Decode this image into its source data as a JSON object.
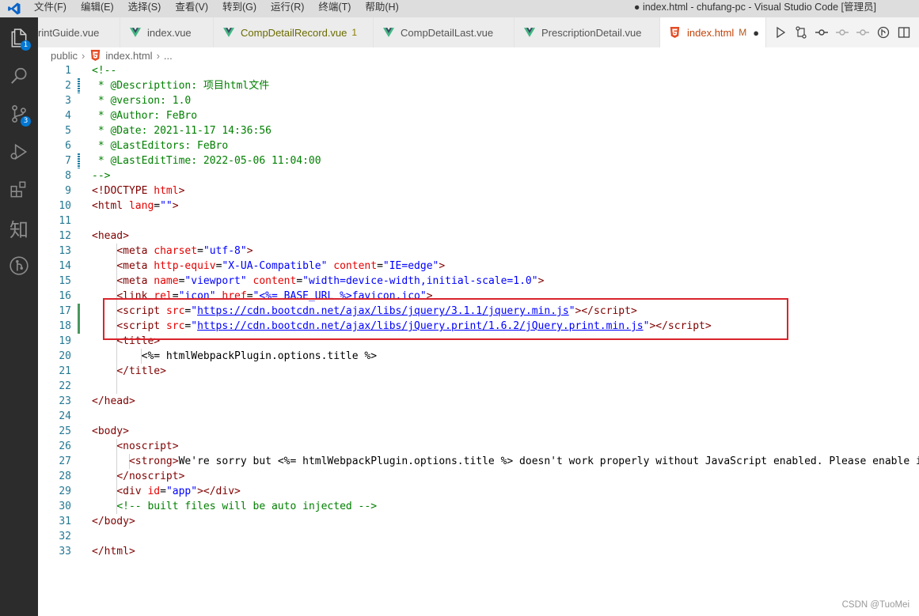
{
  "titlebar": {
    "menu": [
      "文件(F)",
      "编辑(E)",
      "选择(S)",
      "查看(V)",
      "转到(G)",
      "运行(R)",
      "终端(T)",
      "帮助(H)"
    ],
    "window_title": "● index.html - chufang-pc - Visual Studio Code [管理员]"
  },
  "activity_bar": {
    "explorer_badge": "1",
    "scm_badge": "3",
    "zhi_label": "知"
  },
  "tabs": [
    {
      "label": "rintGuide.vue",
      "icon": "vue-icon"
    },
    {
      "label": "index.vue",
      "icon": "vue-icon"
    },
    {
      "label": "CompDetailRecord.vue",
      "icon": "vue-icon",
      "badge": "1"
    },
    {
      "label": "CompDetailLast.vue",
      "icon": "vue-icon"
    },
    {
      "label": "PrescriptionDetail.vue",
      "icon": "vue-icon"
    },
    {
      "label": "index.html",
      "icon": "html5-icon",
      "modified": "M",
      "dirty": "●",
      "active": true
    }
  ],
  "breadcrumb": {
    "folder": "public",
    "file": "index.html",
    "more": "..."
  },
  "code_lines": [
    "1",
    "2",
    "3",
    "4",
    "5",
    "6",
    "7",
    "8",
    "9",
    "10",
    "11",
    "12",
    "13",
    "14",
    "15",
    "16",
    "17",
    "18",
    "19",
    "20",
    "21",
    "22",
    "23",
    "24",
    "25",
    "26",
    "27",
    "28",
    "29",
    "30",
    "31",
    "32",
    "33"
  ],
  "code": {
    "l1": "<!--",
    "l2_star": " * ",
    "l2_text": "@Descripttion: 项目html文件",
    "l3": " * @version: 1.0",
    "l4": " * @Author: FeBro",
    "l5": " * @Date: 2021-11-17 14:36:56",
    "l6": " * @LastEditors: FeBro",
    "l7": " * @LastEditTime: 2022-05-06 11:04:00",
    "l8": "-->",
    "l27_text": "We're sorry but <%= htmlWebpackPlugin.options.title %> doesn't work properly without JavaScript enabled. Please enable it",
    "l20_text": "<%= htmlWebpackPlugin.options.title %>",
    "l30": "<!-- built files will be auto injected -->",
    "jquery_url": "https://cdn.bootcdn.net/ajax/libs/jquery/3.1.1/jquery.min.js",
    "jqprint_url": "https://cdn.bootcdn.net/ajax/libs/jQuery.print/1.6.2/jQuery.print.min.js",
    "favicon": "<%= BASE_URL %>favicon.ico"
  },
  "colors": {
    "activity_bar": "#2c2c2c",
    "highlight_box": "#d9242c",
    "line_number": "#237893"
  },
  "watermark": "CSDN @TuoMei"
}
